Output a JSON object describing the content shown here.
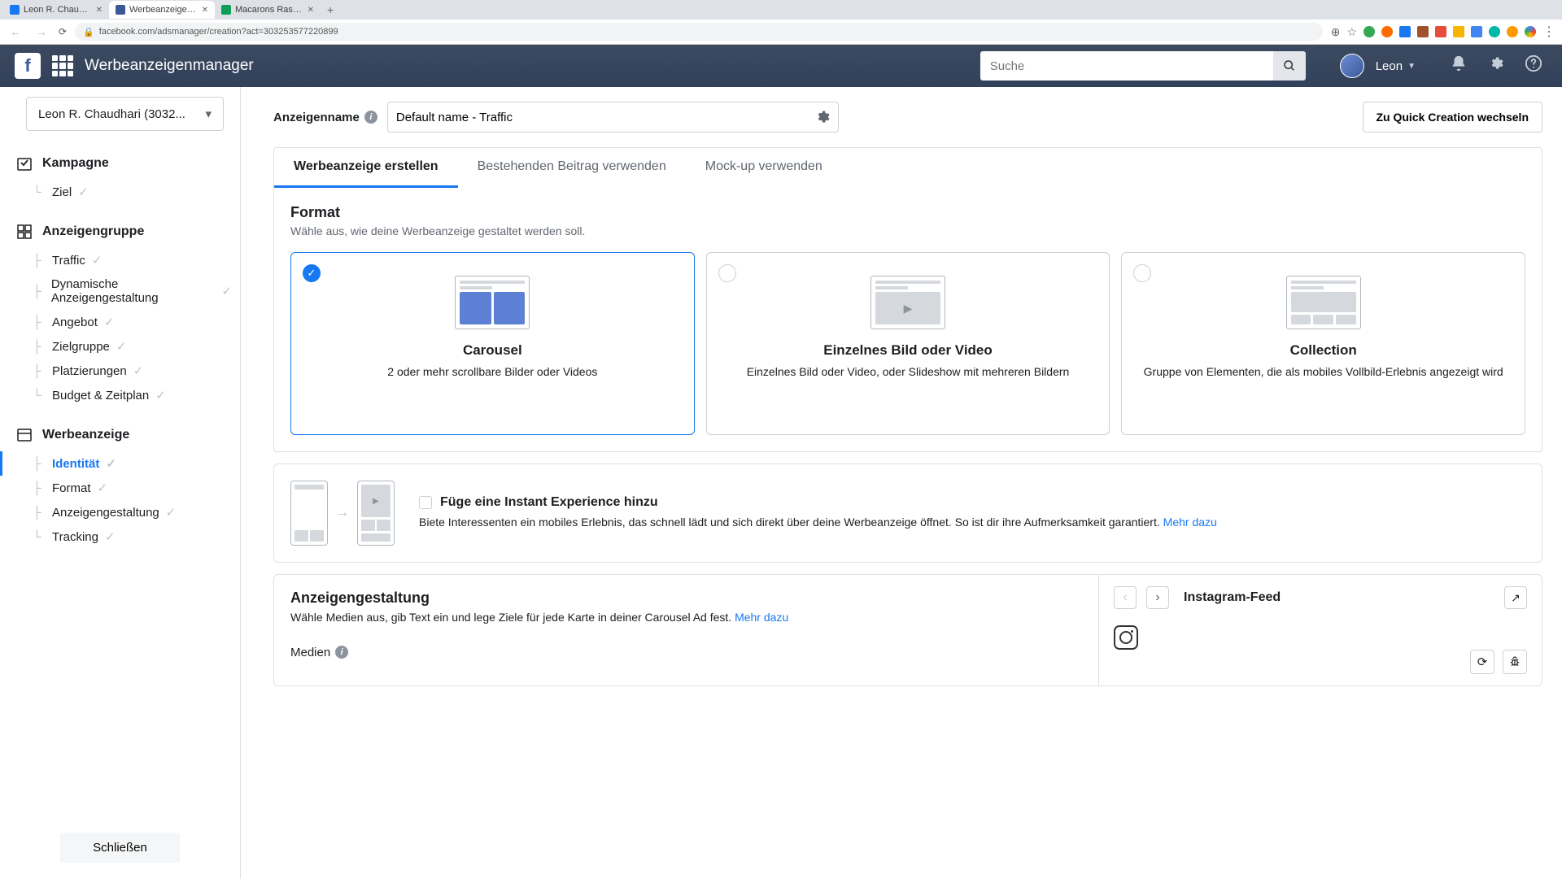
{
  "browser": {
    "tabs": [
      {
        "title": "Leon R. Chaudhari | Facebook",
        "favicon": "#1877f2"
      },
      {
        "title": "Werbeanzeigenmanager - Cre",
        "favicon": "#3b5998"
      },
      {
        "title": "Macarons Raspberries Pastrie",
        "favicon": "#0f9d58"
      }
    ],
    "url": "facebook.com/adsmanager/creation?act=303253577220899"
  },
  "topbar": {
    "app_title": "Werbeanzeigenmanager",
    "search_placeholder": "Suche",
    "user_name": "Leon"
  },
  "sidebar": {
    "account": "Leon R. Chaudhari (3032...",
    "campaign": {
      "label": "Kampagne",
      "items": [
        {
          "label": "Ziel"
        }
      ]
    },
    "adset": {
      "label": "Anzeigengruppe",
      "items": [
        {
          "label": "Traffic"
        },
        {
          "label": "Dynamische Anzeigengestaltung"
        },
        {
          "label": "Angebot"
        },
        {
          "label": "Zielgruppe"
        },
        {
          "label": "Platzierungen"
        },
        {
          "label": "Budget & Zeitplan"
        }
      ]
    },
    "ad": {
      "label": "Werbeanzeige",
      "items": [
        {
          "label": "Identität",
          "active": true
        },
        {
          "label": "Format"
        },
        {
          "label": "Anzeigengestaltung"
        },
        {
          "label": "Tracking"
        }
      ]
    },
    "close": "Schließen"
  },
  "name_row": {
    "label": "Anzeigenname",
    "value": "Default name - Traffic"
  },
  "switch_btn": "Zu Quick Creation wechseln",
  "tabs": [
    "Werbeanzeige erstellen",
    "Bestehenden Beitrag verwenden",
    "Mock-up verwenden"
  ],
  "format": {
    "title": "Format",
    "subtitle": "Wähle aus, wie deine Werbeanzeige gestaltet werden soll.",
    "options": [
      {
        "name": "Carousel",
        "desc": "2 oder mehr scrollbare Bilder oder Videos"
      },
      {
        "name": "Einzelnes Bild oder Video",
        "desc": "Einzelnes Bild oder Video, oder Slideshow mit mehreren Bildern"
      },
      {
        "name": "Collection",
        "desc": "Gruppe von Elementen, die als mobiles Vollbild-Erlebnis angezeigt wird"
      }
    ]
  },
  "instant": {
    "title": "Füge eine Instant Experience hinzu",
    "body": "Biete Interessenten ein mobiles Erlebnis, das schnell lädt und sich direkt über deine Werbeanzeige öffnet. So ist dir ihre Aufmerksamkeit garantiert. ",
    "more": "Mehr dazu"
  },
  "creative": {
    "title": "Anzeigengestaltung",
    "body": "Wähle Medien aus, gib Text ein und lege Ziele für jede Karte in deiner Carousel Ad fest. ",
    "more": "Mehr dazu",
    "media_label": "Medien"
  },
  "preview": {
    "label": "Instagram-Feed"
  }
}
